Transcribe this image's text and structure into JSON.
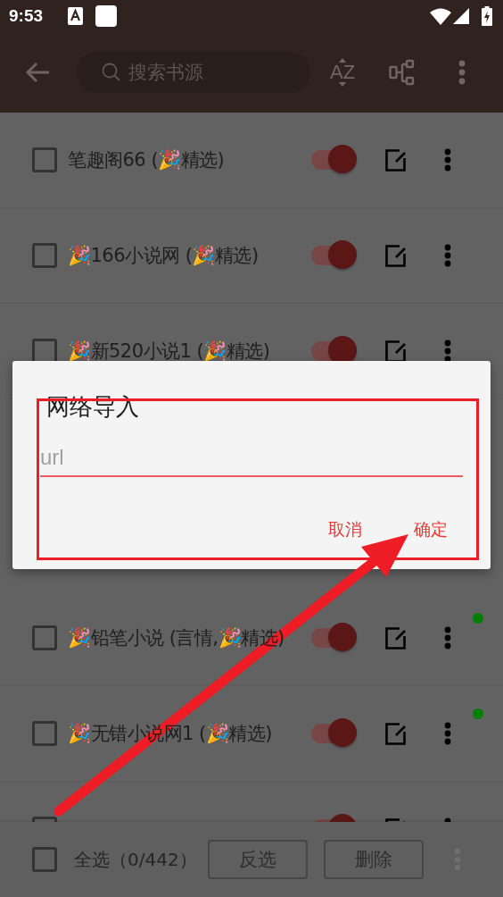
{
  "status_bar": {
    "time": "9:53"
  },
  "toolbar": {
    "search": {
      "placeholder": "搜索书源"
    },
    "sort_label": "AZ"
  },
  "sources_above_dialog": [
    {
      "name": "笔趣阁66 (🎉精选)",
      "checked": false,
      "enabled": true,
      "status_dot": false
    },
    {
      "name": "🎉166小说网 (🎉精选)",
      "checked": false,
      "enabled": true,
      "status_dot": false
    },
    {
      "name": "🎉新520小说1 (🎉精选)",
      "checked": false,
      "enabled": true,
      "status_dot": false
    }
  ],
  "sources_below_dialog": [
    {
      "name": "🎉铅笔小说 (言情,🎉精选)",
      "checked": false,
      "enabled": true,
      "status_dot": true
    },
    {
      "name": "🎉无错小说网1 (🎉精选)",
      "checked": false,
      "enabled": true,
      "status_dot": true
    },
    {
      "checked": false,
      "enabled": true
    }
  ],
  "dialog": {
    "title": "网络导入",
    "field": {
      "placeholder": "url"
    },
    "buttons": [
      "取消",
      "确定"
    ]
  },
  "bottom_bar": {
    "select_all": {
      "label": "全选（0/442）",
      "checked": false
    },
    "buttons": [
      {
        "label": "反选",
        "disabled": true
      },
      {
        "label": "删除",
        "disabled": true
      }
    ]
  },
  "annotations": {
    "highlight_frame": true,
    "arrow": true
  }
}
